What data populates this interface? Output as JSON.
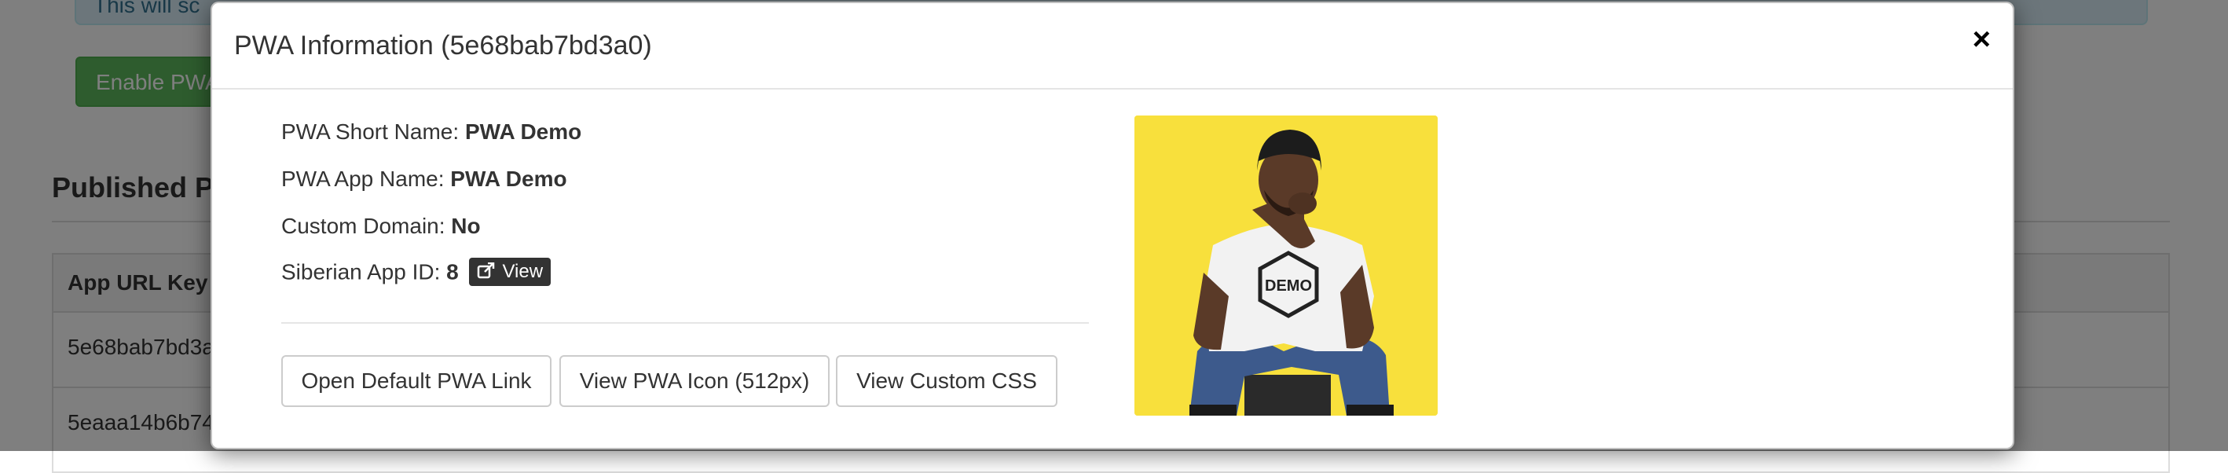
{
  "background": {
    "alert_text": "This will sc",
    "enable_button": "Enable PWA",
    "section_heading": "Published P",
    "table": {
      "header": "App URL Key",
      "rows": [
        "5e68bab7bd3a",
        "5eaaa14b6b74"
      ]
    }
  },
  "modal": {
    "title": "PWA Information (5e68bab7bd3a0)",
    "close_label": "×",
    "fields": {
      "short_name_label": "PWA Short Name: ",
      "short_name_value": "PWA Demo",
      "app_name_label": "PWA App Name: ",
      "app_name_value": "PWA Demo",
      "custom_domain_label": "Custom Domain: ",
      "custom_domain_value": "No",
      "siberian_id_label": "Siberian App ID: ",
      "siberian_id_value": "8",
      "view_label": "View"
    },
    "buttons": {
      "open_link": "Open Default PWA Link",
      "view_icon": "View PWA Icon (512px)",
      "view_css": "View Custom CSS"
    },
    "image": {
      "shirt_text": "DEMO",
      "background_color": "#f8e03c"
    }
  },
  "icons": {
    "close": "close-icon",
    "view": "external-link-icon"
  }
}
